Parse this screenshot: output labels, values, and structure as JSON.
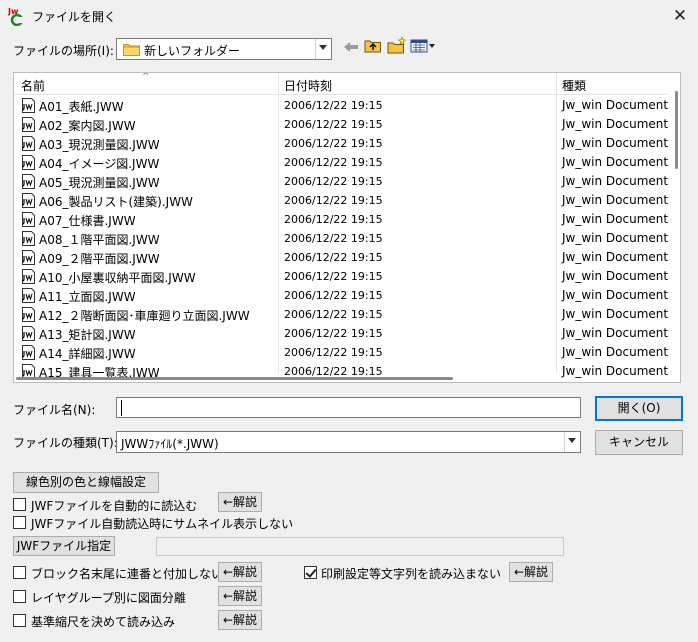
{
  "window": {
    "title": "ファイルを開く",
    "close_glyph": "✕"
  },
  "location": {
    "label": "ファイルの場所(I):",
    "value": "新しいフォルダー"
  },
  "columns": {
    "name": "名前",
    "date": "日付時刻",
    "type": "種類"
  },
  "files": [
    {
      "name": "A01_表紙.JWW",
      "date": "2006/12/22 19:15",
      "type": "Jw_win Document"
    },
    {
      "name": "A02_案内図.JWW",
      "date": "2006/12/22 19:15",
      "type": "Jw_win Document"
    },
    {
      "name": "A03_現況測量図.JWW",
      "date": "2006/12/22 19:15",
      "type": "Jw_win Document"
    },
    {
      "name": "A04_イメージ図.JWW",
      "date": "2006/12/22 19:15",
      "type": "Jw_win Document"
    },
    {
      "name": "A05_現況測量図.JWW",
      "date": "2006/12/22 19:15",
      "type": "Jw_win Document"
    },
    {
      "name": "A06_製品リスト(建築).JWW",
      "date": "2006/12/22 19:15",
      "type": "Jw_win Document"
    },
    {
      "name": "A07_仕様書.JWW",
      "date": "2006/12/22 19:15",
      "type": "Jw_win Document"
    },
    {
      "name": "A08_１階平面図.JWW",
      "date": "2006/12/22 19:15",
      "type": "Jw_win Document"
    },
    {
      "name": "A09_２階平面図.JWW",
      "date": "2006/12/22 19:15",
      "type": "Jw_win Document"
    },
    {
      "name": "A10_小屋裏収納平面図.JWW",
      "date": "2006/12/22 19:15",
      "type": "Jw_win Document"
    },
    {
      "name": "A11_立面図.JWW",
      "date": "2006/12/22 19:15",
      "type": "Jw_win Document"
    },
    {
      "name": "A12_２階断面図･車庫廻り立面図.JWW",
      "date": "2006/12/22 19:15",
      "type": "Jw_win Document"
    },
    {
      "name": "A13_矩計図.JWW",
      "date": "2006/12/22 19:15",
      "type": "Jw_win Document"
    },
    {
      "name": "A14_詳細図.JWW",
      "date": "2006/12/22 19:15",
      "type": "Jw_win Document"
    },
    {
      "name": "A15_建具一覧表.JWW",
      "date": "2006/12/22 19:15",
      "type": "Jw_win Document"
    }
  ],
  "filename": {
    "label": "ファイル名(N):",
    "value": ""
  },
  "filetype": {
    "label": "ファイルの種類(T):",
    "value": "JWWﾌｧｲﾙ(*.JWW)"
  },
  "buttons": {
    "open": "開く(O)",
    "cancel": "キャンセル",
    "line_color": "線色別の色と線幅設定",
    "jwf_specify": "JWFファイル指定",
    "explain": "←解説"
  },
  "options": {
    "jwf_auto_load": {
      "label": "JWFファイルを自動的に読込む",
      "checked": false
    },
    "jwf_no_thumbnail": {
      "label": "JWFファイル自動読込時にサムネイル表示しない",
      "checked": false
    },
    "block_no_serial": {
      "label": "ブロック名末尾に連番と付加しない",
      "checked": false
    },
    "print_settings": {
      "label": "印刷設定等文字列を読み込まない",
      "checked": true
    },
    "layer_group_split": {
      "label": "レイヤグループ別に図面分離",
      "checked": false
    },
    "fixed_scale": {
      "label": "基準縮尺を決めて読み込み",
      "checked": false
    }
  },
  "jwf_path": {
    "value": ""
  },
  "colors": {
    "default_button_border": "#0078d7",
    "folder_yellow": "#f5c342"
  }
}
